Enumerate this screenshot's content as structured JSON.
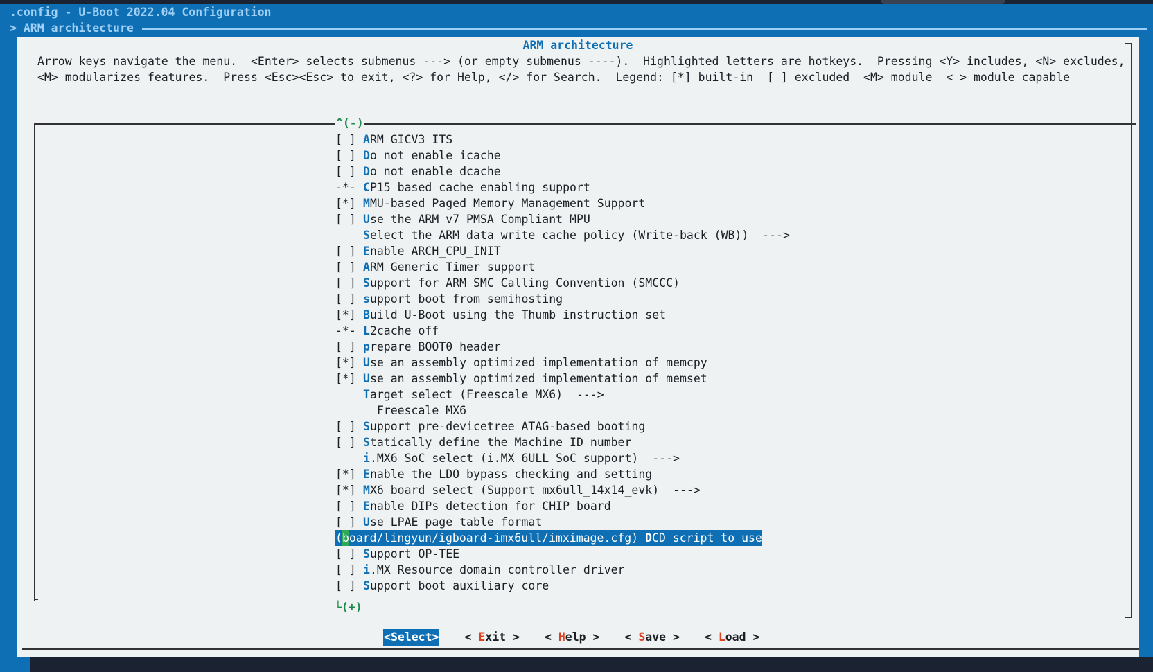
{
  "window": {
    "title": ".config - U-Boot 2022.04 Configuration",
    "breadcrumb": "> ARM architecture"
  },
  "dialog": {
    "title": "ARM architecture",
    "help_text": "Arrow keys navigate the menu.  <Enter> selects submenus ---> (or empty submenus ----).  Highlighted letters are hotkeys.  Pressing <Y> includes, <N> excludes, <M> modularizes features.  Press <Esc><Esc> to exit, <?> for Help, </> for Search.  Legend: [*] built-in  [ ] excluded  <M> module  < > module capable",
    "scroll_up": "^(-)",
    "scroll_down": "└(+)"
  },
  "menu": {
    "items": [
      {
        "mark": "[ ]",
        "hot": "A",
        "rest": "RM GICV3 ITS"
      },
      {
        "mark": "[ ]",
        "hot": "D",
        "rest": "o not enable icache"
      },
      {
        "mark": "[ ]",
        "hot": "D",
        "rest": "o not enable dcache"
      },
      {
        "mark": "-*-",
        "hot": "C",
        "rest": "P15 based cache enabling support"
      },
      {
        "mark": "[*]",
        "hot": "M",
        "rest": "MU-based Paged Memory Management Support"
      },
      {
        "mark": "[ ]",
        "hot": "U",
        "rest": "se the ARM v7 PMSA Compliant MPU"
      },
      {
        "mark": "",
        "hot": "S",
        "rest": "elect the ARM data write cache policy (Write-back (WB))  --->"
      },
      {
        "mark": "[ ]",
        "hot": "E",
        "rest": "nable ARCH_CPU_INIT"
      },
      {
        "mark": "[ ]",
        "hot": "A",
        "rest": "RM Generic Timer support"
      },
      {
        "mark": "[ ]",
        "hot": "S",
        "rest": "upport for ARM SMC Calling Convention (SMCCC)"
      },
      {
        "mark": "[ ]",
        "hot": "s",
        "rest": "upport boot from semihosting"
      },
      {
        "mark": "[*]",
        "hot": "B",
        "rest": "uild U-Boot using the Thumb instruction set"
      },
      {
        "mark": "-*-",
        "hot": "L",
        "rest": "2cache off"
      },
      {
        "mark": "[ ]",
        "hot": "p",
        "rest": "repare BOOT0 header"
      },
      {
        "mark": "[*]",
        "hot": "U",
        "rest": "se an assembly optimized implementation of memcpy"
      },
      {
        "mark": "[*]",
        "hot": "U",
        "rest": "se an assembly optimized implementation of memset"
      },
      {
        "mark": "",
        "hot": "T",
        "rest": "arget select (Freescale MX6)  --->"
      },
      {
        "mark": "",
        "hot": "",
        "rest": "  Freescale MX6"
      },
      {
        "mark": "[ ]",
        "hot": "S",
        "rest": "upport pre-devicetree ATAG-based booting"
      },
      {
        "mark": "[ ]",
        "hot": "S",
        "rest": "tatically define the Machine ID number"
      },
      {
        "mark": "",
        "hot": "i",
        "rest": ".MX6 SoC select (i.MX 6ULL SoC support)  --->"
      },
      {
        "mark": "[*]",
        "hot": "E",
        "rest": "nable the LDO bypass checking and setting"
      },
      {
        "mark": "[*]",
        "hot": "M",
        "rest": "X6 board select (Support mx6ull_14x14_evk)  --->"
      },
      {
        "mark": "[ ]",
        "hot": "E",
        "rest": "nable DIPs detection for CHIP board"
      },
      {
        "mark": "[ ]",
        "hot": "U",
        "rest": "se LPAE page table format"
      }
    ],
    "selected": {
      "open_paren": "(",
      "cursor_char": "b",
      "value_rest": "oard/lingyun/igboard-imx6ull/imximage.cfg) ",
      "hot": "D",
      "rest": "CD script to use"
    },
    "items_after": [
      {
        "mark": "[ ]",
        "hot": "S",
        "rest": "upport OP-TEE"
      },
      {
        "mark": "[ ]",
        "hot": "i",
        "rest": ".MX Resource domain controller driver"
      },
      {
        "mark": "[ ]",
        "hot": "S",
        "rest": "upport boot auxiliary core"
      }
    ]
  },
  "buttons": [
    {
      "pre": "<",
      "hot": "S",
      "post": "elect>",
      "active": true
    },
    {
      "pre": "< ",
      "hot": "E",
      "post": "xit >",
      "active": false
    },
    {
      "pre": "< ",
      "hot": "H",
      "post": "elp >",
      "active": false
    },
    {
      "pre": "< ",
      "hot": "S",
      "post": "ave >",
      "active": false
    },
    {
      "pre": "< ",
      "hot": "L",
      "post": "oad >",
      "active": false
    }
  ],
  "colors": {
    "terminal_blue": "#0f6fb5",
    "dialog_bg": "#eef2f3",
    "hotkey_blue": "#0f6fb5",
    "button_hotkey_red": "#e04020",
    "scroll_green": "#1f8a4c",
    "cursor_green": "#2fa85a"
  }
}
